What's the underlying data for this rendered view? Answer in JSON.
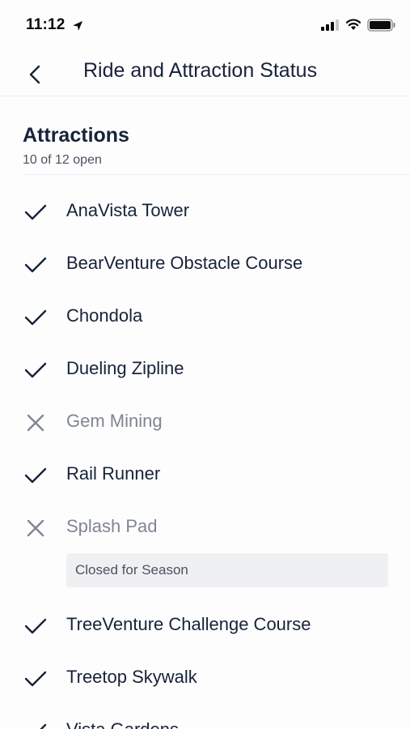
{
  "status_bar": {
    "time": "11:12",
    "icons": [
      "location-arrow-icon",
      "cellular-signal-icon",
      "wifi-icon",
      "battery-icon"
    ]
  },
  "header": {
    "back_icon": "chevron-left-icon",
    "title": "Ride and Attraction Status"
  },
  "section": {
    "title": "Attractions",
    "subtitle": "10 of 12 open"
  },
  "colors": {
    "text_primary": "#17233a",
    "text_closed": "#7f8693",
    "note_background": "#eff0f2"
  },
  "attractions": [
    {
      "name": "AnaVista Tower",
      "status": "open",
      "icon": "checkmark-icon"
    },
    {
      "name": "BearVenture Obstacle Course",
      "status": "open",
      "icon": "checkmark-icon"
    },
    {
      "name": "Chondola",
      "status": "open",
      "icon": "checkmark-icon"
    },
    {
      "name": "Dueling Zipline",
      "status": "open",
      "icon": "checkmark-icon"
    },
    {
      "name": "Gem Mining",
      "status": "closed",
      "icon": "x-icon"
    },
    {
      "name": "Rail Runner",
      "status": "open",
      "icon": "checkmark-icon"
    },
    {
      "name": "Splash Pad",
      "status": "closed",
      "icon": "x-icon",
      "note": "Closed for Season"
    },
    {
      "name": "TreeVenture Challenge Course",
      "status": "open",
      "icon": "checkmark-icon"
    },
    {
      "name": "Treetop Skywalk",
      "status": "open",
      "icon": "checkmark-icon"
    },
    {
      "name": "Vista Gardens",
      "status": "open",
      "icon": "checkmark-icon"
    }
  ]
}
